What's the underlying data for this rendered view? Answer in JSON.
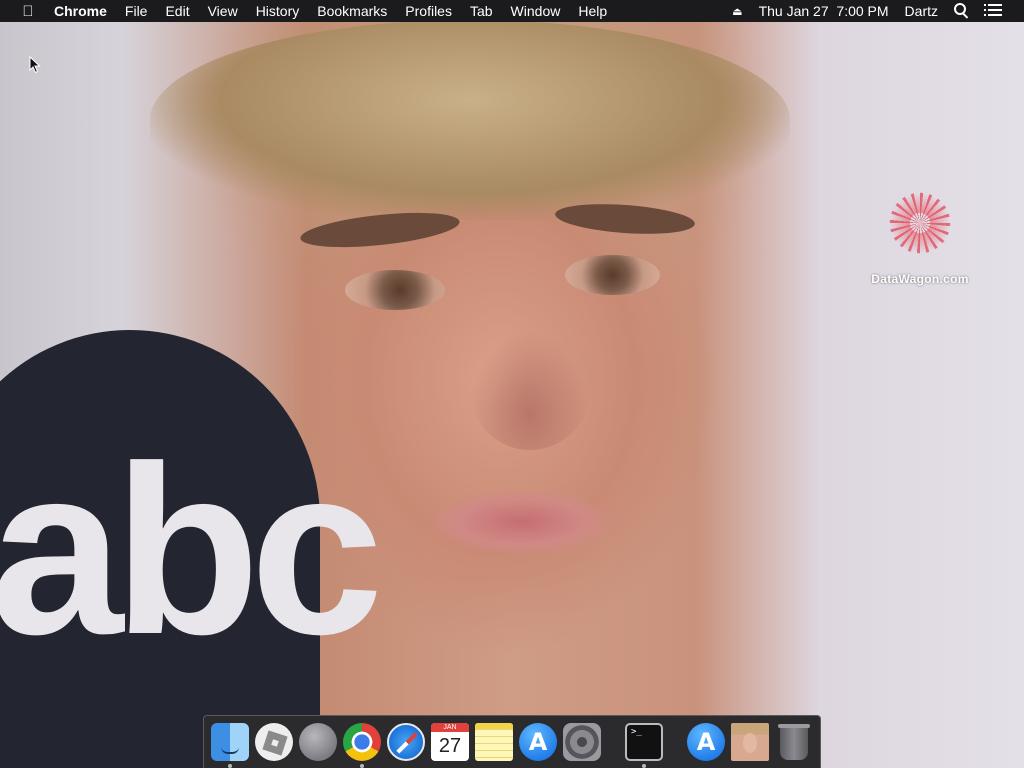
{
  "menubar": {
    "apple_icon": "apple-icon",
    "app_name": "Chrome",
    "items": [
      "File",
      "Edit",
      "View",
      "History",
      "Bookmarks",
      "Profiles",
      "Tab",
      "Window",
      "Help"
    ],
    "status": {
      "eject_icon": "eject-icon",
      "datetime": "Thu Jan 27  7:00 PM",
      "user": "Dartz",
      "search_icon": "spotlight-search-icon",
      "control_icon": "notification-center-icon"
    }
  },
  "desktop": {
    "watermark_text": "DataWagon.com",
    "wallpaper_logo_text": "abc"
  },
  "dock": {
    "apps": [
      {
        "name": "Finder",
        "icon": "finder-icon",
        "running": true
      },
      {
        "name": "Roblox",
        "icon": "roblox-icon",
        "running": false
      },
      {
        "name": "Launchpad",
        "icon": "launchpad-icon",
        "running": false
      },
      {
        "name": "Google Chrome",
        "icon": "chrome-icon",
        "running": true
      },
      {
        "name": "Safari",
        "icon": "safari-icon",
        "running": false
      },
      {
        "name": "Calendar",
        "icon": "calendar-icon",
        "running": false,
        "month": "JAN",
        "day": "27"
      },
      {
        "name": "Notes",
        "icon": "notes-icon",
        "running": false
      },
      {
        "name": "App Store",
        "icon": "app-store-icon",
        "running": false
      },
      {
        "name": "System Preferences",
        "icon": "system-preferences-icon",
        "running": false
      },
      {
        "name": "Terminal",
        "icon": "terminal-icon",
        "running": true
      },
      {
        "name": "App Store Downloads",
        "icon": "downloads-app-store-icon",
        "running": false
      },
      {
        "name": "Photo",
        "icon": "photo-thumbnail-icon",
        "running": false
      },
      {
        "name": "Trash",
        "icon": "trash-icon",
        "running": false
      }
    ]
  },
  "colors": {
    "menubar_bg": "#1b1b1d",
    "dock_bg": "#2b2b2e",
    "watermark_accent": "#e4505c"
  }
}
